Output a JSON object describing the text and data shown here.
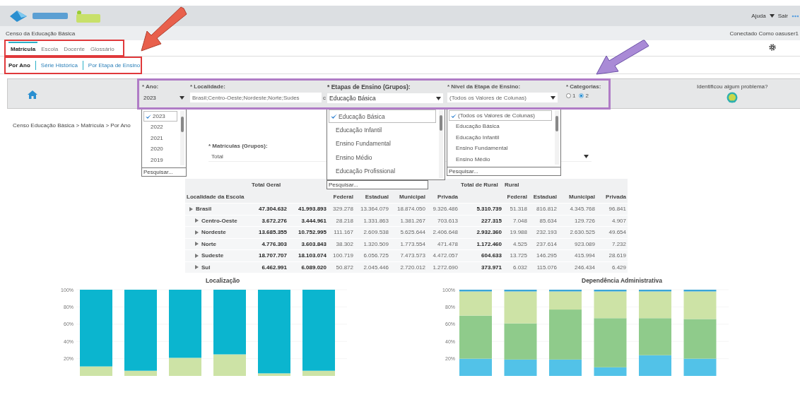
{
  "header": {
    "help_menu": "Ajuda",
    "logout": "Sair"
  },
  "app_title": "Censo da Educação Básica",
  "connected_label": "Conectado Como",
  "username": "oasuser1",
  "tabs": [
    {
      "label": "Matrícula",
      "selected": true
    },
    {
      "label": "Escola",
      "selected": false
    },
    {
      "label": "Docente",
      "selected": false
    },
    {
      "label": "Glossário",
      "selected": false
    }
  ],
  "subtabs": [
    {
      "label": "Por Ano",
      "selected": true
    },
    {
      "label": "Série Histórica",
      "selected": false
    },
    {
      "label": "Por Etapa de Ensino",
      "selected": false
    }
  ],
  "filters": {
    "ano": {
      "label": "* Ano:",
      "value": "2023",
      "options": [
        {
          "label": "2023",
          "selected": true
        },
        {
          "label": "2022",
          "selected": false
        },
        {
          "label": "2021",
          "selected": false
        },
        {
          "label": "2020",
          "selected": false
        },
        {
          "label": "2019",
          "selected": false
        }
      ],
      "search_placeholder": "Pesquisar..."
    },
    "localidade": {
      "label": "* Localidade:",
      "value": "Brasil;Centro-Oeste;Nordeste;Norte;Sudes",
      "button_text": "c"
    },
    "etapas": {
      "label": "* Etapas de Ensino (Grupos):",
      "value": "Educação Básica",
      "options": [
        {
          "label": "Educação Básica",
          "selected": true
        },
        {
          "label": "Educação Infantil",
          "selected": false
        },
        {
          "label": "Ensino Fundamental",
          "selected": false
        },
        {
          "label": "Ensino Médio",
          "selected": false
        },
        {
          "label": "Educação Profissional",
          "selected": false
        }
      ],
      "search_placeholder": "Pesquisar..."
    },
    "nivel": {
      "label": "* Nível da Etapa de Ensino:",
      "value": "(Todos os Valores de Colunas)",
      "options": [
        {
          "label": "(Todos os Valores de Colunas)",
          "selected": true
        },
        {
          "label": "Educação Básica",
          "selected": false
        },
        {
          "label": "Educação Infantil",
          "selected": false
        },
        {
          "label": "Ensino Fundamental",
          "selected": false
        },
        {
          "label": "Ensino Médio",
          "selected": false
        }
      ],
      "search_placeholder": "Pesquisar..."
    },
    "categorias": {
      "label": "* Categorias:",
      "options": [
        {
          "label": "1",
          "selected": false
        },
        {
          "label": "2",
          "selected": true
        }
      ]
    }
  },
  "problem_link": "Identificou algum problema?",
  "breadcrumb": "Censo Educação Básica > Matrícula > Por Ano",
  "matriculas": {
    "label": "* Matrículas (Grupos):",
    "value": "Total"
  },
  "table": {
    "columns": [
      {
        "kind": "name",
        "label": "Localidade da Escola"
      },
      {
        "kind": "total",
        "top": "Total Geral"
      },
      {
        "kind": "total"
      },
      {
        "kind": "value",
        "label": "Federal"
      },
      {
        "kind": "value",
        "label": "Estadual"
      },
      {
        "kind": "value",
        "label": "Municipal"
      },
      {
        "kind": "value",
        "label": "Privada"
      },
      {
        "kind": "total",
        "top": "Total de Rural"
      },
      {
        "kind": "value",
        "top": "Rural",
        "label": "Federal"
      },
      {
        "kind": "value",
        "label": "Estadual"
      },
      {
        "kind": "value",
        "label": "Municipal"
      },
      {
        "kind": "value",
        "label": "Privada"
      }
    ],
    "rows": [
      {
        "cells": [
          "Brasil",
          "47.304.632",
          "41.993.893",
          "329.278",
          "13.364.079",
          "18.874.050",
          "9.326.486",
          "5.310.739",
          "51.318",
          "816.812",
          "4.345.768",
          "96.841"
        ],
        "children": [
          {
            "cells": [
              "Centro-Oeste",
              "3.672.276",
              "3.444.961",
              "28.218",
              "1.331.863",
              "1.381.267",
              "703.613",
              "227.315",
              "7.048",
              "85.634",
              "129.726",
              "4.907"
            ]
          },
          {
            "cells": [
              "Nordeste",
              "13.685.355",
              "10.752.995",
              "111.167",
              "2.609.538",
              "5.625.644",
              "2.406.648",
              "2.932.360",
              "19.988",
              "232.193",
              "2.630.525",
              "49.654"
            ]
          },
          {
            "cells": [
              "Norte",
              "4.776.303",
              "3.603.843",
              "38.302",
              "1.320.509",
              "1.773.554",
              "471.478",
              "1.172.460",
              "4.525",
              "237.614",
              "923.089",
              "7.232"
            ]
          },
          {
            "cells": [
              "Sudeste",
              "18.707.707",
              "18.103.074",
              "100.719",
              "6.056.725",
              "7.473.573",
              "4.472.057",
              "604.633",
              "13.725",
              "146.295",
              "415.994",
              "28.619"
            ]
          },
          {
            "cells": [
              "Sul",
              "6.462.991",
              "6.089.020",
              "50.872",
              "2.045.446",
              "2.720.012",
              "1.272.690",
              "373.971",
              "6.032",
              "115.076",
              "246.434",
              "6.429"
            ]
          }
        ]
      }
    ]
  },
  "charts": [
    {
      "chart_data": {
        "type": "bar",
        "title": "Localização",
        "stacked": true,
        "grid": true,
        "ylim": [
          0,
          1
        ],
        "yticks": [
          {
            "value": 1,
            "label": "100%"
          },
          {
            "value": 0.8,
            "label": "80%"
          },
          {
            "value": 0.6,
            "label": "60%"
          },
          {
            "value": 0.4,
            "label": "40%"
          },
          {
            "value": 0.2,
            "label": "20%"
          }
        ],
        "series": [
          {
            "color": "#cde3a6",
            "values": [
              0.11,
              0.06,
              0.21,
              0.25,
              0.03,
              0.06
            ]
          },
          {
            "color": "#0bb5cf",
            "values": [
              0.89,
              0.94,
              0.79,
              0.75,
              0.97,
              0.94
            ]
          }
        ]
      }
    },
    {
      "chart_data": {
        "type": "bar",
        "title": "Dependência Administrativa",
        "stacked": true,
        "grid": true,
        "ylim": [
          0,
          1
        ],
        "yticks": [
          {
            "value": 1,
            "label": "100%"
          },
          {
            "value": 0.8,
            "label": "80%"
          },
          {
            "value": 0.6,
            "label": "60%"
          },
          {
            "value": 0.4,
            "label": "40%"
          },
          {
            "value": 0.2,
            "label": "20%"
          }
        ],
        "series": [
          {
            "color": "#52c2e8",
            "values": [
              0.2,
              0.19,
              0.19,
              0.1,
              0.24,
              0.2
            ]
          },
          {
            "color": "#8fcb8b",
            "values": [
              0.5,
              0.42,
              0.58,
              0.57,
              0.43,
              0.46
            ]
          },
          {
            "color": "#cde3a6",
            "values": [
              0.28,
              0.37,
              0.21,
              0.31,
              0.31,
              0.32
            ]
          },
          {
            "color": "#3aa6d8",
            "values": [
              0.02,
              0.02,
              0.02,
              0.02,
              0.02,
              0.02
            ]
          }
        ]
      }
    }
  ]
}
